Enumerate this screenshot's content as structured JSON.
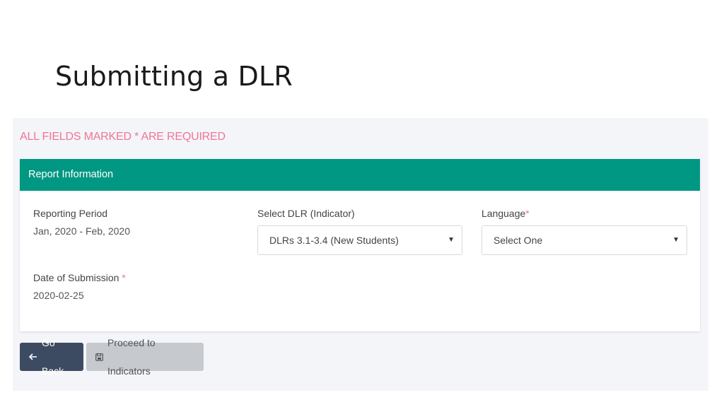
{
  "slide": {
    "title": "Submitting a DLR"
  },
  "form": {
    "required_note": "ALL FIELDS MARKED * ARE REQUIRED",
    "card_title": "Report Information",
    "reporting_period": {
      "label": "Reporting Period",
      "value": "Jan, 2020 - Feb, 2020"
    },
    "select_dlr": {
      "label": "Select DLR (Indicator)",
      "selected": "DLRs 3.1-3.4 (New Students)"
    },
    "language": {
      "label": "Language",
      "required_mark": "*",
      "selected": "Select One"
    },
    "date_of_submission": {
      "label": "Date of Submission ",
      "required_mark": "*",
      "value": "2020-02-25"
    }
  },
  "buttons": {
    "back_label": "Go Back",
    "proceed_label": "Proceed to Indicators"
  },
  "icons": {
    "back": "arrow-left-icon",
    "proceed": "floppy-disk-icon",
    "dropdown": "caret-down-icon"
  },
  "colors": {
    "accent": "#009783",
    "required": "#f07598",
    "back_button": "#3d4b62",
    "proceed_button": "#c6c9cd"
  }
}
